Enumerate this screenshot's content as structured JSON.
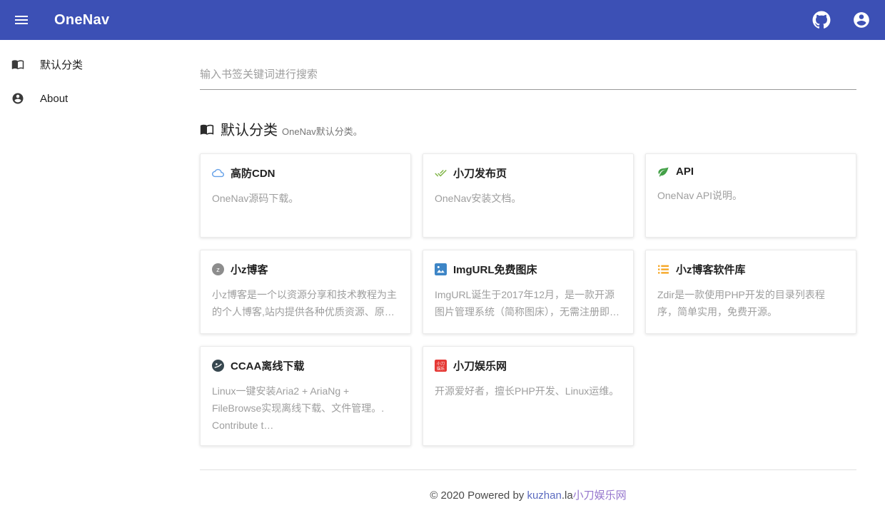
{
  "navbar": {
    "title": "OneNav",
    "icons": [
      "menu-icon",
      "github-icon",
      "account-icon"
    ],
    "color": "#3c50b5"
  },
  "sidebar": {
    "items": [
      {
        "label": "默认分类",
        "icon": "book-icon"
      },
      {
        "label": "About",
        "icon": "person-icon"
      }
    ]
  },
  "search": {
    "placeholder": "输入书签关键词进行搜索"
  },
  "section": {
    "icon": "book-icon",
    "title": "默认分类",
    "subtitle": "OneNav默认分类。"
  },
  "cards": [
    {
      "title": "高防CDN",
      "desc": "OneNav源码下载。",
      "icon": "cloud-icon",
      "icon_color": "#64a0e8"
    },
    {
      "title": "小刀发布页",
      "desc": "OneNav安装文档。",
      "icon": "check-icon",
      "icon_color": "#7cb342"
    },
    {
      "title": "API",
      "desc": "OneNav API说明。",
      "icon": "leaf-icon",
      "icon_color": "#43a047"
    },
    {
      "title": "小z博客",
      "desc": "小z博客是一个以资源分享和技术教程为主的个人博客,站内提供各种优质资源、原…",
      "icon": "z-avatar-icon",
      "icon_color": "#8d8d8d"
    },
    {
      "title": "ImgURL免费图床",
      "desc": "ImgURL诞生于2017年12月，是一款开源图片管理系统（简称图床），无需注册即…",
      "icon": "image-icon",
      "icon_color": "#3d85c6"
    },
    {
      "title": "小z博客软件库",
      "desc": "Zdir是一款使用PHP开发的目录列表程序，简单实用，免费开源。",
      "icon": "list-icon",
      "icon_color": "#f6a623"
    },
    {
      "title": "CCAA离线下载",
      "desc": "Linux一键安装Aria2 + AriaNg + FileBrowse实现离线下载、文件管理。. Contribute t…",
      "icon": "globe-icon",
      "icon_color": "#37474f"
    },
    {
      "title": "小刀娱乐网",
      "desc": "开源爱好者，擅长PHP开发、Linux运维。",
      "icon": "site-badge-icon",
      "icon_color": "#e53935"
    }
  ],
  "footer": {
    "prefix": "© 2020 Powered by ",
    "link_domain": "kuzhan",
    "domain_suffix": ".la",
    "link_site": "小刀娱乐网",
    "link_blue": "#5c6bc0",
    "link_purple": "#9575cd"
  }
}
